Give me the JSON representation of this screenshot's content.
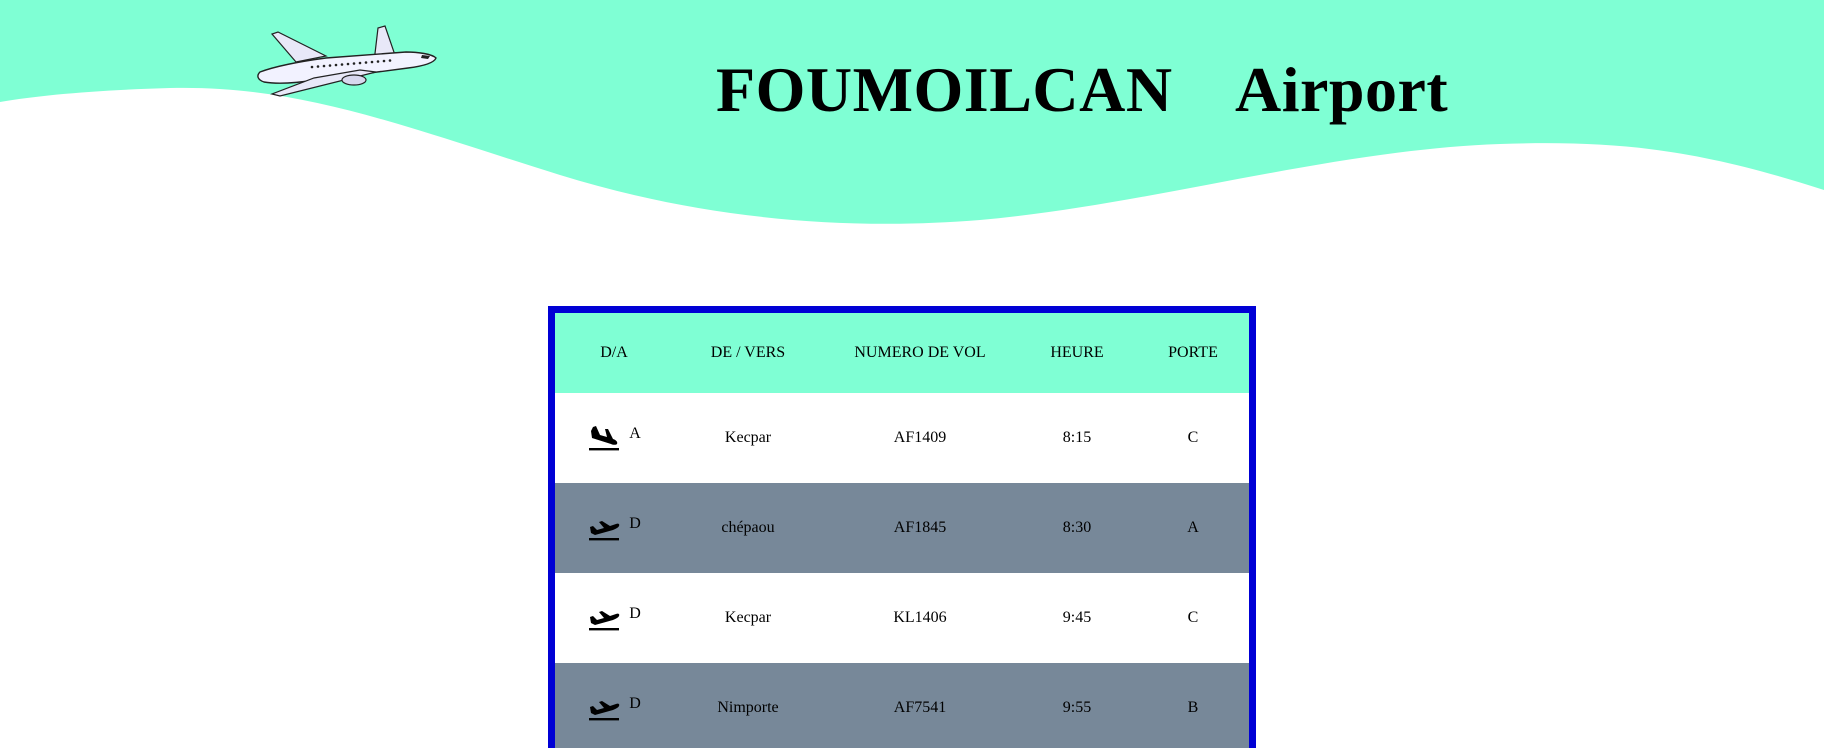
{
  "header": {
    "title": "FOUMOILCAN    Airport",
    "colors": {
      "wave": "#7fffd4"
    },
    "logo_icon": "airplane-icon"
  },
  "board": {
    "colors": {
      "border": "#0000d5",
      "header_bg": "#7fffd4",
      "row_alt": "#778899",
      "row": "#ffffff"
    },
    "columns": [
      "D/A",
      "DE / VERS",
      "NUMERO DE VOL",
      "HEURE",
      "PORTE"
    ],
    "rows": [
      {
        "type": "A",
        "icon": "arrival-icon",
        "place": "Kecpar",
        "flight": "AF1409",
        "time": "8:15",
        "gate": "C"
      },
      {
        "type": "D",
        "icon": "departure-icon",
        "place": "chépaou",
        "flight": "AF1845",
        "time": "8:30",
        "gate": "A"
      },
      {
        "type": "D",
        "icon": "departure-icon",
        "place": "Kecpar",
        "flight": "KL1406",
        "time": "9:45",
        "gate": "C"
      },
      {
        "type": "D",
        "icon": "departure-icon",
        "place": "Nimporte",
        "flight": "AF7541",
        "time": "9:55",
        "gate": "B"
      }
    ]
  }
}
